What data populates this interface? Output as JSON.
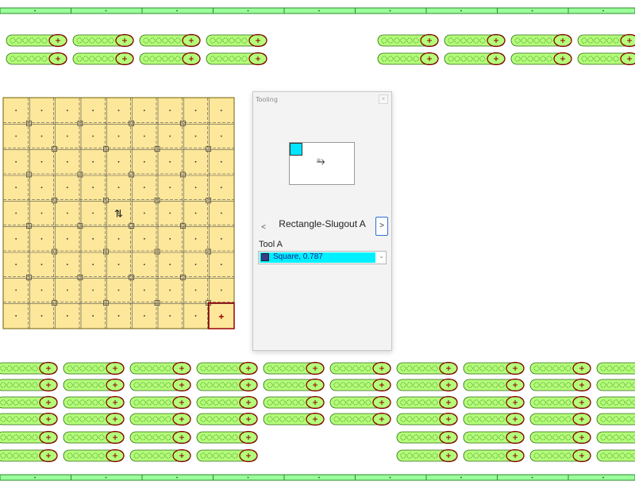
{
  "dialog": {
    "title": "Tooling",
    "close_glyph": "×",
    "prev_glyph": "<",
    "next_glyph": ">",
    "tool_name": "Rectangle-Slugout A",
    "tool_label": "Tool A",
    "preview_glyph": "⥱",
    "tool_select": {
      "value": "Square, 0.787",
      "swatch_color": "#3b3b8a",
      "highlight_color": "#00f0ff",
      "arrow_glyph": "⌄"
    }
  },
  "sheet": {
    "fill_color": "#fce79a",
    "border_color": "#6f6000",
    "selected_cell_color": "#a00000",
    "center_glyph": "⇅",
    "grid_cols": 9,
    "grid_rows": 9
  },
  "parts": {
    "fill_color": "#b4ff7a",
    "ring_color": "#8b0000"
  },
  "rails": {
    "fill_color": "#9aff9a",
    "border_color": "#2c8a2c"
  }
}
